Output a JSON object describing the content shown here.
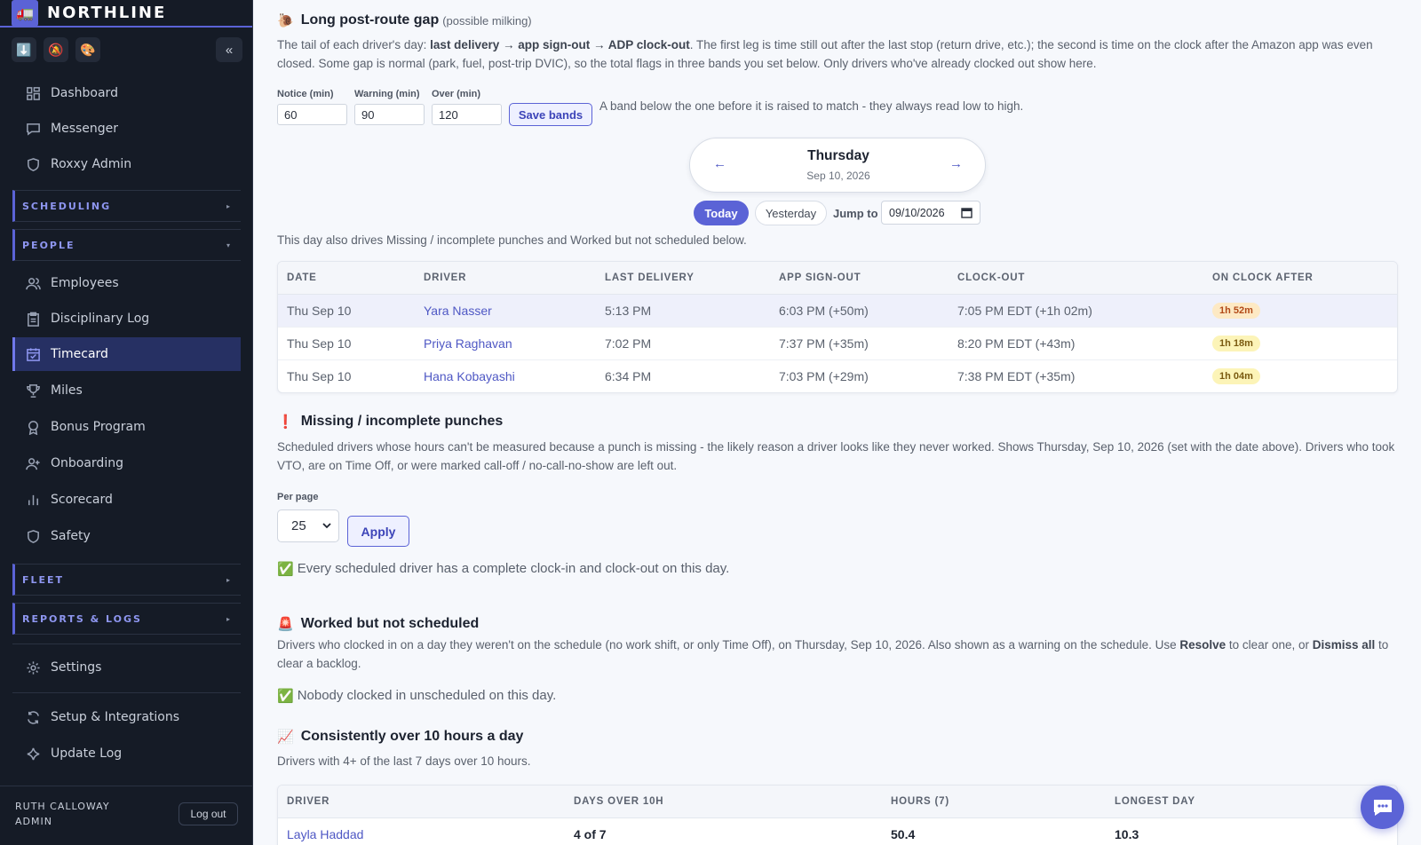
{
  "brand": {
    "name": "NORTHLINE",
    "logo": "🚛"
  },
  "sidebar": {
    "tools": [
      "⬇️",
      "🔕",
      "🎨"
    ],
    "collapse": "«",
    "items_top": [
      {
        "label": "Dashboard",
        "icon": "dashboard-icon"
      },
      {
        "label": "Messenger",
        "icon": "message-icon"
      },
      {
        "label": "Roxxy Admin",
        "icon": "shield-icon"
      }
    ],
    "sections": {
      "scheduling": "SCHEDULING",
      "people": "PEOPLE",
      "fleet": "FLEET",
      "reports": "REPORTS & LOGS"
    },
    "people_items": [
      {
        "label": "Employees"
      },
      {
        "label": "Disciplinary Log"
      },
      {
        "label": "Timecard"
      },
      {
        "label": "Miles"
      },
      {
        "label": "Bonus Program"
      },
      {
        "label": "Onboarding"
      },
      {
        "label": "Scorecard"
      },
      {
        "label": "Safety"
      }
    ],
    "bottom_items": [
      {
        "label": "Settings"
      },
      {
        "label": "Setup & Integrations"
      },
      {
        "label": "Update Log"
      }
    ],
    "user": {
      "name": "RUTH CALLOWAY",
      "role": "ADMIN",
      "logout": "Log out"
    }
  },
  "gap": {
    "emoji": "🐌",
    "title": "Long post-route gap",
    "subtitle": "(possible milking)",
    "desc_1": "The tail of each driver's day: ",
    "desc_b1": "last delivery → app sign-out → ADP clock-out",
    "desc_2": ". The first leg is time still out after the last stop (return drive, etc.); the second is time on the clock after the Amazon app was even closed. Some gap is normal (park, fuel, post-trip DVIC), so the total flags in three bands you set below. Only drivers who've already clocked out show here.",
    "notice_label": "Notice (min)",
    "notice_value": "60",
    "warning_label": "Warning (min)",
    "warning_value": "90",
    "over_label": "Over (min)",
    "over_value": "120",
    "save": "Save bands",
    "band_note": "A band below the one before it is raised to match - they always read low to high."
  },
  "day": {
    "prev": "←",
    "next": "→",
    "weekday": "Thursday",
    "date": "Sep 10, 2026",
    "today": "Today",
    "yesterday": "Yesterday",
    "jump_label": "Jump to",
    "jump_value": "09/10/2026",
    "note": "This day also drives Missing / incomplete punches and Worked but not scheduled below."
  },
  "gap_table": {
    "headers": [
      "DATE",
      "DRIVER",
      "LAST DELIVERY",
      "APP SIGN-OUT",
      "CLOCK-OUT",
      "ON CLOCK AFTER"
    ],
    "rows": [
      {
        "date": "Thu Sep 10",
        "driver": "Yara Nasser",
        "last": "5:13 PM",
        "signout": "6:03 PM (+50m)",
        "clockout": "7:05 PM EDT (+1h 02m)",
        "after": "1h 52m"
      },
      {
        "date": "Thu Sep 10",
        "driver": "Priya Raghavan",
        "last": "7:02 PM",
        "signout": "7:37 PM (+35m)",
        "clockout": "8:20 PM EDT (+43m)",
        "after": "1h 18m"
      },
      {
        "date": "Thu Sep 10",
        "driver": "Hana Kobayashi",
        "last": "6:34 PM",
        "signout": "7:03 PM (+29m)",
        "clockout": "7:38 PM EDT (+35m)",
        "after": "1h 04m"
      }
    ]
  },
  "missing": {
    "emoji": "❗",
    "title": "Missing / incomplete punches",
    "desc": "Scheduled drivers whose hours can't be measured because a punch is missing - the likely reason a driver looks like they never worked. Shows Thursday, Sep 10, 2026 (set with the date above). Drivers who took VTO, are on Time Off, or were marked call-off / no-call-no-show are left out.",
    "per_page_label": "Per page",
    "per_page_value": "25",
    "apply": "Apply",
    "ok_emoji": "✅",
    "ok": "Every scheduled driver has a complete clock-in and clock-out on this day."
  },
  "unscheduled": {
    "emoji": "🚨",
    "title": "Worked but not scheduled",
    "desc_1": "Drivers who clocked in on a day they weren't on the schedule (no work shift, or only Time Off), on Thursday, Sep 10, 2026. Also shown as a warning on the schedule. Use ",
    "desc_b1": "Resolve",
    "desc_2": " to clear one, or ",
    "desc_b2": "Dismiss all",
    "desc_3": " to clear a backlog.",
    "ok_emoji": "✅",
    "ok": "Nobody clocked in unscheduled on this day."
  },
  "overtime": {
    "emoji": "📈",
    "title": "Consistently over 10 hours a day",
    "desc": "Drivers with 4+ of the last 7 days over 10 hours.",
    "headers": [
      "DRIVER",
      "DAYS OVER 10H",
      "HOURS (7)",
      "LONGEST DAY"
    ],
    "rows": [
      {
        "driver": "Layla Haddad",
        "days": "4 of 7",
        "hours": "50.4",
        "longest": "10.3"
      }
    ]
  },
  "colors": {
    "accent": "#5b63d6",
    "sidebar": "#151b26",
    "active": "#263063"
  }
}
